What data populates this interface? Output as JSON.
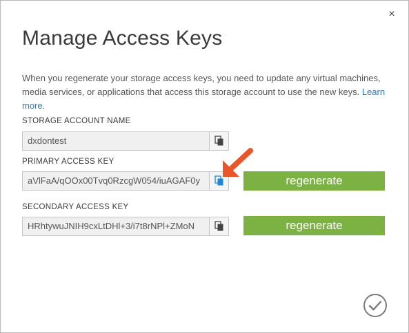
{
  "dialog": {
    "title": "Manage Access Keys",
    "close_label": "×",
    "description": "When you regenerate your storage access keys, you need to update any virtual machines, media services, or applications that access this storage account to use the new keys.",
    "learn_more": "Learn more."
  },
  "storage_account": {
    "label": "STORAGE ACCOUNT NAME",
    "value": "dxdontest"
  },
  "primary_key": {
    "label": "PRIMARY ACCESS KEY",
    "value": "aVlFaA/qOOx00Tvq0RzcgW054/iuAGAF0y",
    "regenerate_label": "regenerate"
  },
  "secondary_key": {
    "label": "SECONDARY ACCESS KEY",
    "value": "HRhtywuJNIH9cxLtDHl+3/i7t8rNPl+ZMoN",
    "regenerate_label": "regenerate"
  },
  "icons": {
    "close": "close-icon",
    "copy": "copy-icon",
    "arrow": "annotation-arrow-icon",
    "confirm": "checkmark-icon"
  },
  "colors": {
    "button_green": "#7bb243",
    "link_blue": "#2e7ab8",
    "arrow_orange": "#e8562a",
    "copy_highlight": "#1e88d6"
  }
}
